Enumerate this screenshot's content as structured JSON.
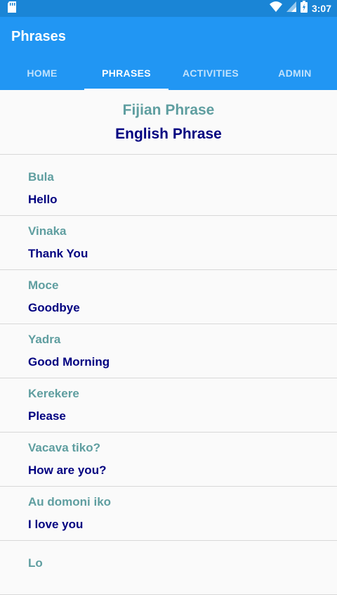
{
  "status_bar": {
    "time": "3:07"
  },
  "toolbar": {
    "title": "Phrases"
  },
  "tabs": [
    {
      "label": "HOME",
      "active": false
    },
    {
      "label": "PHRASES",
      "active": true
    },
    {
      "label": "ACTIVITIES",
      "active": false
    },
    {
      "label": "ADMIN",
      "active": false
    }
  ],
  "header": {
    "fijian": "Fijian Phrase",
    "english": "English Phrase"
  },
  "phrases": [
    {
      "fijian": "Bula",
      "english": "Hello"
    },
    {
      "fijian": "Vinaka",
      "english": "Thank You"
    },
    {
      "fijian": "Moce",
      "english": "Goodbye"
    },
    {
      "fijian": "Yadra",
      "english": "Good Morning"
    },
    {
      "fijian": "Kerekere",
      "english": "Please"
    },
    {
      "fijian": "Vacava tiko?",
      "english": "How are you?"
    },
    {
      "fijian": "Au domoni iko",
      "english": "I love you"
    },
    {
      "fijian": "Lo",
      "english": ""
    }
  ],
  "colors": {
    "status_bar": "#1a85d6",
    "app_bar": "#2196f3",
    "fijian_text": "#5f9ea0",
    "english_text": "#000080"
  }
}
